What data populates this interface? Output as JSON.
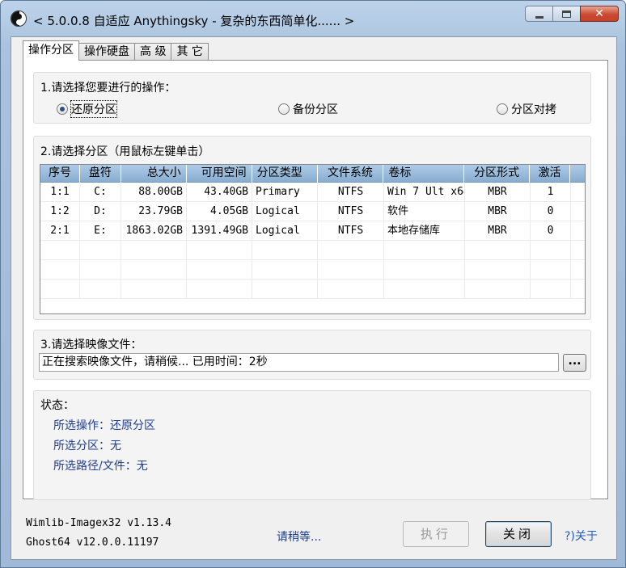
{
  "window": {
    "title": "< 5.0.0.8 自适应 Anythingsky - 复杂的东西简单化...... >",
    "minimize_icon": "minimize-icon",
    "maximize_icon": "maximize-icon",
    "close_glyph": "✕"
  },
  "tabs": [
    {
      "label": "操作分区",
      "active": true
    },
    {
      "label": "操作硬盘",
      "active": false
    },
    {
      "label": "高 级",
      "active": false
    },
    {
      "label": "其 它",
      "active": false
    }
  ],
  "section1": {
    "label": "1.请选择您要进行的操作：",
    "options": [
      {
        "label": "还原分区",
        "checked": true
      },
      {
        "label": "备份分区",
        "checked": false
      },
      {
        "label": "分区对拷",
        "checked": false
      }
    ]
  },
  "section2": {
    "label": "2.请选择分区（用鼠标左键单击）",
    "columns": [
      "序号",
      "盘符",
      "总大小",
      "可用空间",
      "分区类型",
      "文件系统",
      "卷标",
      "分区形式",
      "激活"
    ],
    "rows": [
      [
        "1:1",
        "C:",
        "88.00GB",
        "43.40GB",
        "Primary",
        "NTFS",
        "Win 7 Ult x64",
        "MBR",
        "1"
      ],
      [
        "1:2",
        "D:",
        "23.79GB",
        "4.05GB",
        "Logical",
        "NTFS",
        "软件",
        "MBR",
        "0"
      ],
      [
        "2:1",
        "E:",
        "1863.02GB",
        "1391.49GB",
        "Logical",
        "NTFS",
        "本地存储库",
        "MBR",
        "0"
      ]
    ]
  },
  "section3": {
    "label": "3.请选择映像文件：",
    "file_value": "正在搜索映像文件，请稍候...  已用时间：2秒",
    "browse_label": "..."
  },
  "status": {
    "label": "状态：",
    "lines": [
      "所选操作：还原分区",
      "所选分区：无",
      "所选路径/文件：无"
    ]
  },
  "footer": {
    "version1": "Wimlib-Imagex32 v1.13.4",
    "version2": "Ghost64 v12.0.0.11197",
    "wait_text": "请稍等...",
    "execute_label": "执行",
    "close_label": "关闭",
    "about_label": "?)关于"
  },
  "colors": {
    "status_text": "#1f3e8c",
    "link": "#1f5dc4",
    "header_bg": "#9dbcdc"
  }
}
